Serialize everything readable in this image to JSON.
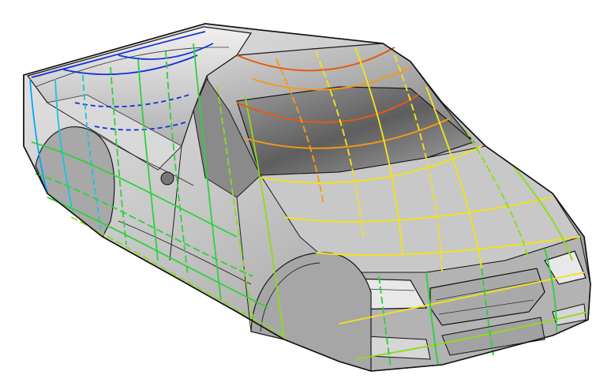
{
  "scene": {
    "subject": "pickup-truck-surface-model",
    "background_color": "#ffffff",
    "body_color": "#b9b9b9",
    "edge_color": "#1a1a1a",
    "curvature_colors": [
      "#1230d8",
      "#00a8ff",
      "#17c8d8",
      "#2fd23a",
      "#8edb1b",
      "#f2e21a",
      "#f59a12",
      "#e85a0c"
    ]
  }
}
